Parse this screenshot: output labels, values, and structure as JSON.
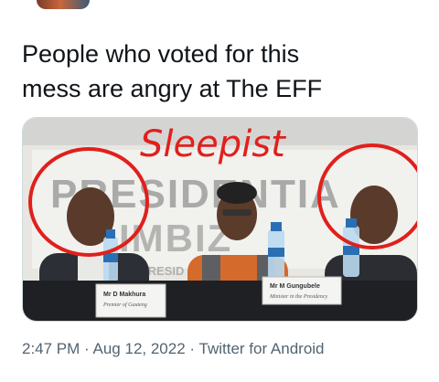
{
  "tweet": {
    "text_lines": [
      "People who voted for this",
      "mess are angry at The EFF"
    ]
  },
  "media": {
    "overlay_caption": "Sleepist",
    "banner_text": "PRESIDENTIA",
    "banner_sub": "IMBIZ",
    "banner_small": "PRESID",
    "placards": [
      {
        "name": "Mr D Makhura",
        "title": "Premier of Gauteng"
      },
      {
        "name": "Mr M Gungubele",
        "title": "Minister in the Presidency"
      }
    ],
    "annotation_color": "#e0201c"
  },
  "meta": {
    "time": "2:47 PM",
    "dot1": "·",
    "date": "Aug 12, 2022",
    "dot2": "·",
    "source": "Twitter for Android"
  }
}
